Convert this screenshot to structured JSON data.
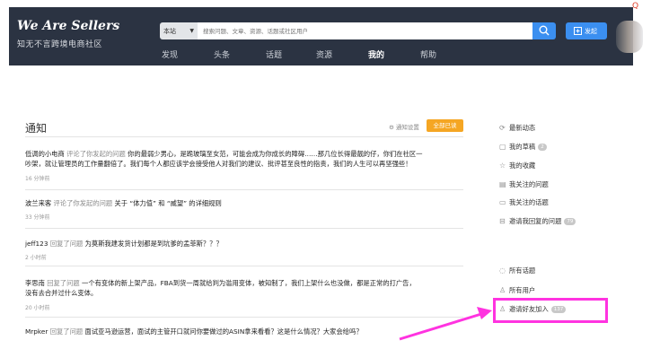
{
  "header": {
    "logo_title": "We Are Sellers",
    "logo_subtitle": "知无不言跨境电商社区",
    "search_scope": "本站",
    "search_placeholder": "搜索问题、文章、资源、话题或社区用户",
    "post_label": "发起",
    "nav": [
      "发现",
      "头条",
      "话题",
      "资源",
      "我的",
      "帮助"
    ],
    "nav_active": "我的"
  },
  "notices": {
    "title": "通知",
    "settings_label": "通知设置",
    "mark_all_read": "全部已读",
    "items": [
      {
        "actor": "低调的小电商",
        "verb": "评论了你发起的问题",
        "text_line1": "你的最弱少男心，是跪玻璃至女范，可能会成为你成长的障碍……那几位长得最靓的仔，你们在社区一",
        "text_line2": "吵架，就让管理员的工作量翻倍了。我们每个人都应该学会接受他人对我们的建议、批评甚至良性的指责，我们的人生可以再坚强些！",
        "time": "16 分钟前"
      },
      {
        "actor": "波兰来客",
        "verb": "评论了你发起的问题",
        "text_line1": "关于 “体力值” 和 “威望” 的详细规则",
        "text_line2": "",
        "time": "33 分钟前"
      },
      {
        "actor": "jeff123",
        "verb": "回复了问题",
        "text_line1": "为莫斯我建发货计划都是到坑爹的孟菲斯？？？",
        "text_line2": "",
        "time": "2 小时前"
      },
      {
        "actor": "李思南",
        "verb": "回复了问题",
        "text_line1": "一个有变体的新上架产品，FBA到货一周就给判为滥用变体，被知制了，我们上架什么也没做，都是正常的打广告，",
        "text_line2": "没有去合并过什么变体。",
        "time": "20 小时前"
      },
      {
        "actor": "Mrpker",
        "verb": "回复了问题",
        "text_line1": "面试亚马逊运营，面试的主管开口就问你要做过的ASIN拿来看看？这是什么情况？大家会给吗？",
        "text_line2": "",
        "time": ""
      }
    ]
  },
  "sidebar": {
    "items": [
      {
        "label": "最新动态",
        "icon": "refresh-icon",
        "glyph": "⟳",
        "badge": ""
      },
      {
        "label": "我的草稿",
        "icon": "draft-icon",
        "glyph": "▢",
        "badge": "2"
      },
      {
        "label": "我的收藏",
        "icon": "star-icon",
        "glyph": "☆",
        "badge": ""
      },
      {
        "label": "我关注的问题",
        "icon": "doc-icon",
        "glyph": "▤",
        "badge": ""
      },
      {
        "label": "我关注的话题",
        "icon": "chat-icon",
        "glyph": "▭",
        "badge": ""
      },
      {
        "label": "邀请我回复的问题",
        "icon": "inbox-icon",
        "glyph": "⊟",
        "badge": "79"
      },
      {
        "label": "所有话题",
        "icon": "topic-icon",
        "glyph": "◌",
        "badge": ""
      },
      {
        "label": "所有用户",
        "icon": "user-icon",
        "glyph": "♙",
        "badge": ""
      },
      {
        "label": "邀请好友加入",
        "icon": "invite-user-icon",
        "glyph": "♙",
        "badge": "137"
      }
    ]
  },
  "colors": {
    "header_bg": "#2b3342",
    "accent_blue": "#3b8ff0",
    "accent_orange": "#f5a623",
    "highlight_magenta": "#ff33e0"
  }
}
